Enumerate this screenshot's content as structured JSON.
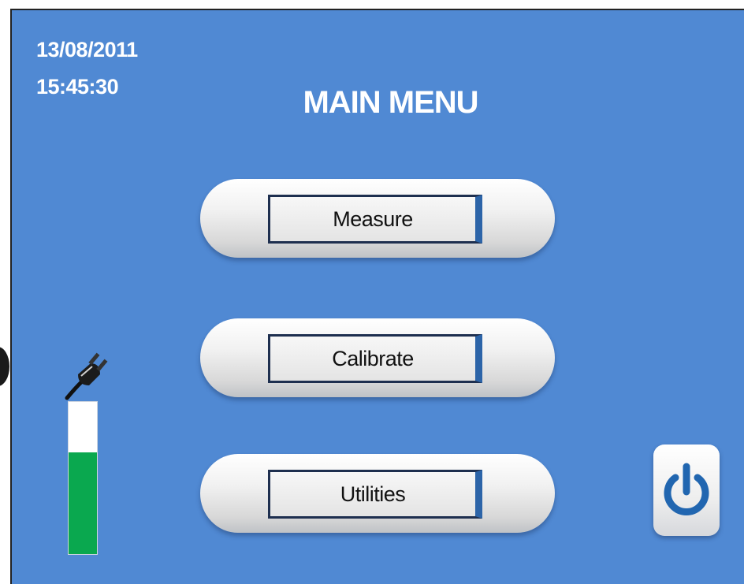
{
  "header": {
    "date": "13/08/2011",
    "time": "15:45:30",
    "title": "MAIN MENU"
  },
  "menu": {
    "items": [
      {
        "label": "Measure"
      },
      {
        "label": "Calibrate"
      },
      {
        "label": "Utilities"
      }
    ]
  },
  "status": {
    "power_source_icon": "plug-icon",
    "battery_level": 0.67,
    "battery_color": "#0aa84f"
  },
  "controls": {
    "power_icon": "power-icon"
  },
  "colors": {
    "background": "#5089d3",
    "accent": "#2c64a8"
  }
}
